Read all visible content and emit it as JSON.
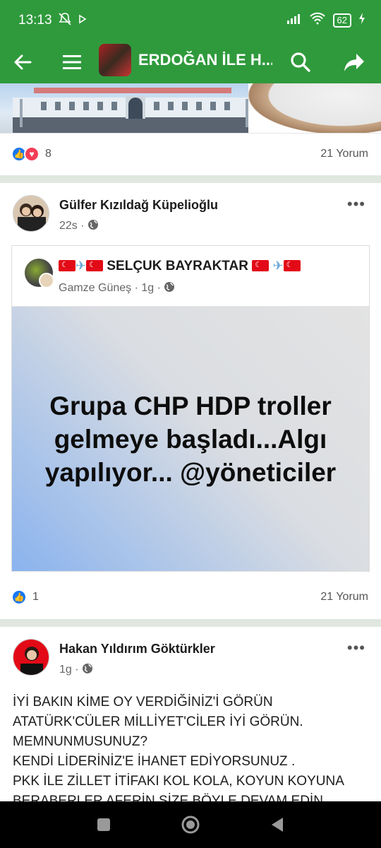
{
  "status": {
    "time": "13:13",
    "battery": "62"
  },
  "appbar": {
    "title": "ERDOĞAN İLE H..."
  },
  "post1": {
    "reaction_count": "8",
    "comments": "21 Yorum"
  },
  "post2": {
    "author": "Gülfer Kızıldağ Küpelioğlu",
    "time": "22s",
    "shared": {
      "page_name": "SELÇUK BAYRAKTAR",
      "author": "Gamze Güneş",
      "time": "1g",
      "text": "Grupa CHP HDP troller gelmeye başladı...Algı yapılıyor... @yöneticiler"
    },
    "reaction_count": "1",
    "comments": "21 Yorum"
  },
  "post3": {
    "author": "Hakan Yıldırım Göktürkler",
    "time": "1g",
    "lines": [
      "İYİ BAKIN KİME OY VERDİĞİNİZ'İ GÖRÜN",
      "ATATÜRK'CÜLER MİLLİYET'CİLER İYİ GÖRÜN.",
      "MEMNUNMUSUNUZ?",
      "KENDİ LİDERİNİZ'E İHANET EDİYORSUNUZ .",
      "PKK İLE ZİLLET İTİFAKI KOL KOLA, KOYUN KOYUNA",
      "BERABERLER AFERİN SİZE BÖYLE DEVAM EDİN"
    ]
  },
  "icons": {
    "back": "arrow-left-icon",
    "menu": "hamburger-icon",
    "search": "search-icon",
    "share": "share-icon",
    "globe": "globe-icon",
    "more": "more-horizontal-icon"
  },
  "colors": {
    "brand": "#2f9a3c",
    "like": "#1877f2",
    "love": "#f33e58"
  }
}
